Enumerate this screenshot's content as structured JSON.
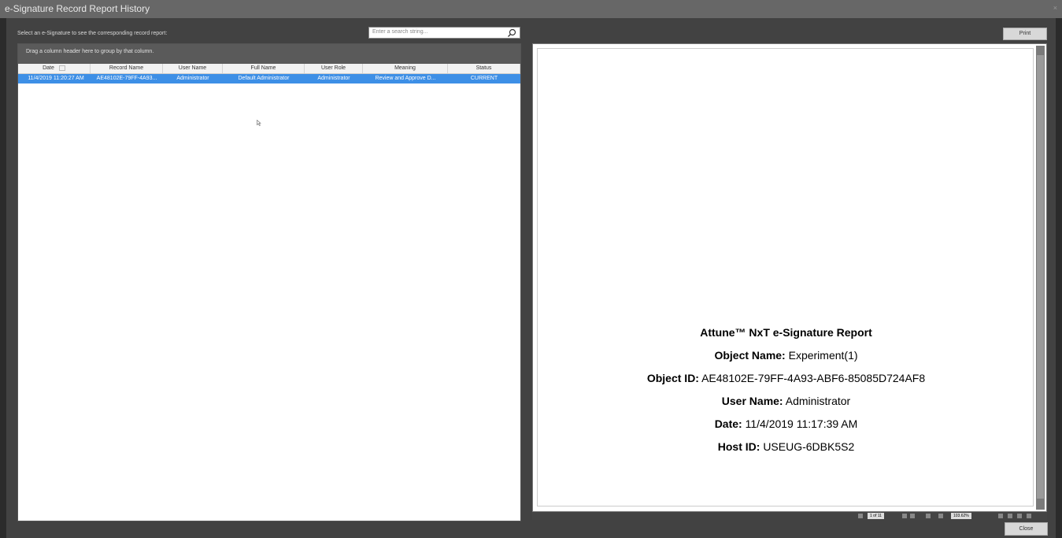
{
  "window": {
    "title": "e-Signature Record Report History",
    "close_glyph": "×"
  },
  "instruction": "Select an e-Signature to see the corresponding record report:",
  "search": {
    "placeholder": "Enter a search string...",
    "icon": "search-icon"
  },
  "grid": {
    "group_hint": "Drag a column header here to group by that column.",
    "columns": [
      "Date",
      "Record Name",
      "User Name",
      "Full Name",
      "User Role",
      "Meaning",
      "Status"
    ],
    "rows": [
      {
        "date": "11/4/2019 11:20:27 AM",
        "record_name": "AE48102E-79FF-4A93...",
        "user_name": "Administrator",
        "full_name": "Default Administrator",
        "user_role": "Administrator",
        "meaning": "Review and Approve D...",
        "status": "CURRENT"
      }
    ],
    "selected_row_color": "#3d8fe6"
  },
  "toolbar": {
    "print_label": "Print",
    "close_label": "Close"
  },
  "report": {
    "title": "Attune™ NxT e-Signature Report",
    "fields": [
      {
        "label": "Object Name:",
        "value": "Experiment(1)"
      },
      {
        "label": "Object ID:",
        "value": "AE48102E-79FF-4A93-ABF6-85085D724AF8"
      },
      {
        "label": "User Name:",
        "value": "Administrator"
      },
      {
        "label": "Date:",
        "value": "11/4/2019 11:17:39 AM"
      },
      {
        "label": "Host ID:",
        "value": "USEUG-6DBK5S2"
      }
    ]
  },
  "viewer": {
    "page_indicator": "1 of 11",
    "zoom": "103.62%"
  },
  "colors": {
    "titlebar": "#676767",
    "dialog_bg": "#424242",
    "accent": "#3d8fe6"
  }
}
